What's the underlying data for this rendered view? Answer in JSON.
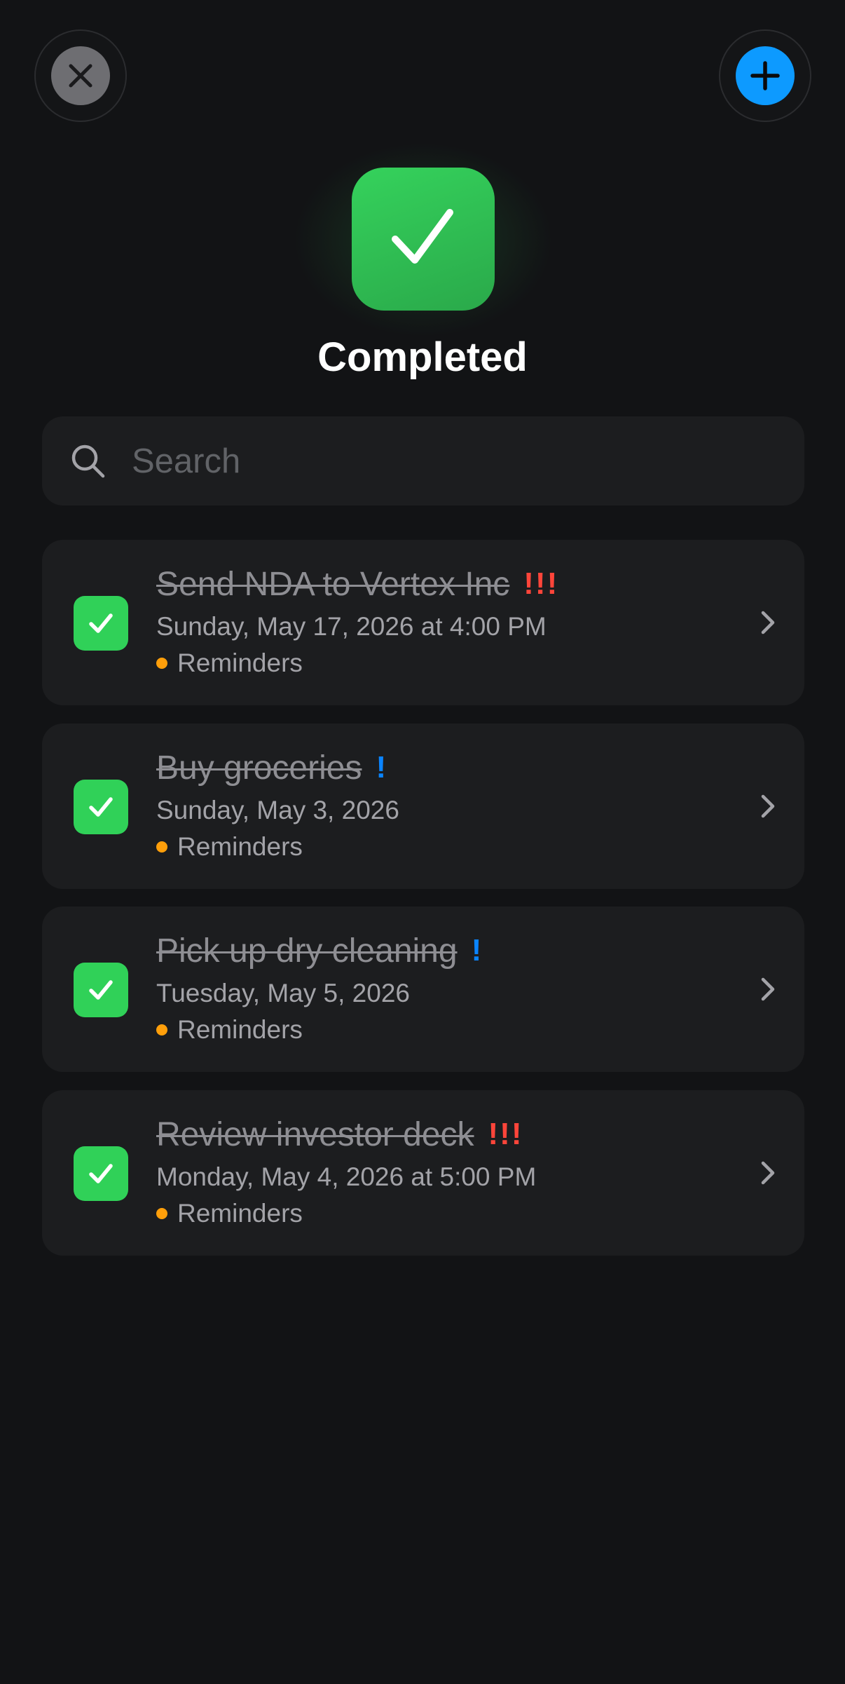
{
  "header": {
    "close_icon": "xmark-icon",
    "add_icon": "plus-icon",
    "add_color": "#0D9AFF"
  },
  "hero": {
    "icon": "checkmark-icon",
    "icon_color": "#30D158",
    "title": "Completed"
  },
  "search": {
    "placeholder": "Search",
    "value": ""
  },
  "reminders": [
    {
      "title": "Send NDA to Vertex Inc",
      "priority": "!!!",
      "priority_level": "high",
      "date": "Sunday, May 17, 2026 at 4:00 PM",
      "list": "Reminders",
      "completed": true
    },
    {
      "title": "Buy groceries",
      "priority": "!",
      "priority_level": "low",
      "date": "Sunday, May 3, 2026",
      "list": "Reminders",
      "completed": true
    },
    {
      "title": "Pick up dry cleaning",
      "priority": "!",
      "priority_level": "low",
      "date": "Tuesday, May 5, 2026",
      "list": "Reminders",
      "completed": true
    },
    {
      "title": "Review investor deck",
      "priority": "!!!",
      "priority_level": "high",
      "date": "Monday, May 4, 2026 at 5:00 PM",
      "list": "Reminders",
      "completed": true
    }
  ],
  "colors": {
    "background": "#121315",
    "card": "#1C1D1F",
    "check": "#30D158",
    "list_dot": "#FF9F0A",
    "priority_high": "#FF453A",
    "priority_low": "#0A84FF"
  }
}
